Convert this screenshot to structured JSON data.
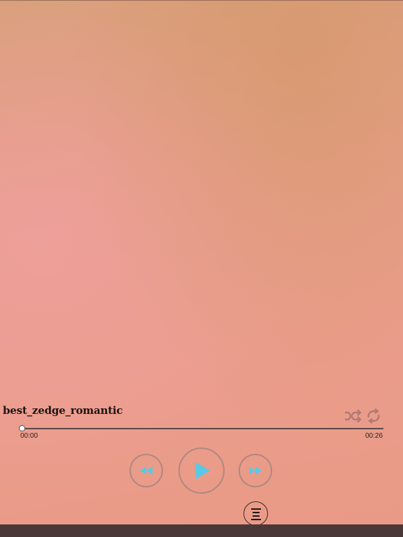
{
  "player": {
    "track_title": "best_zedge_romantic",
    "time_elapsed": "00:00",
    "time_total": "00:26",
    "progress": 0,
    "colors": {
      "accent": "#5bc8e6",
      "text": "#1f1414"
    },
    "icons": [
      "shuffle-icon",
      "repeat-icon",
      "rewind-icon",
      "play-icon",
      "fast-forward-icon",
      "playlist-icon"
    ]
  },
  "bottom_bar": {
    "text": ""
  }
}
